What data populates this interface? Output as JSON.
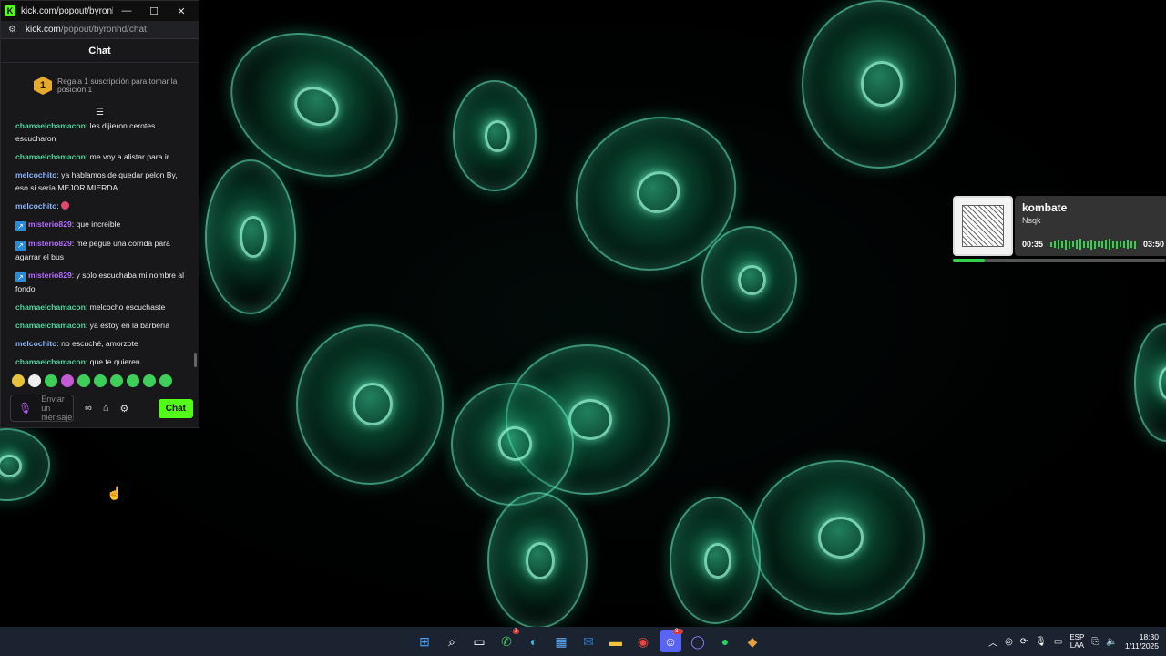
{
  "window": {
    "title": "kick.com/popout/byronhd/c...",
    "url_host": "kick.com",
    "url_path": "/popout/byronhd/chat",
    "minimize": "—",
    "maximize": "☐",
    "close": "✕"
  },
  "chat": {
    "header": "Chat",
    "promo_rank": "1",
    "promo_text": "Regala 1 suscripción para tomar la posición 1",
    "messages": [
      {
        "user": "chamaelchamacon",
        "text": ": les dijieron cerotes escucharon"
      },
      {
        "user": "chamaelchamacon",
        "text": ": me voy a alistar para ir"
      },
      {
        "user": "melcochito",
        "text": ": ya hablamos de quedar pelon By, eso si sería MEJOR MIERDA"
      },
      {
        "user": "melcochito",
        "text": ": "
      },
      {
        "user": "misterio829",
        "text": ": que increible"
      },
      {
        "user": "misterio829",
        "text": ": me pegue una corrida para agarrar el bus"
      },
      {
        "user": "misterio829",
        "text": ": y solo escuchaba mi nombre al fondo"
      },
      {
        "user": "chamaelchamacon",
        "text": ": melcocho escuchaste"
      },
      {
        "user": "chamaelchamacon",
        "text": ": ya estoy en la barbería"
      },
      {
        "user": "melcochito",
        "text": ": no escuché, amorzote"
      },
      {
        "user": "chamaelchamacon",
        "text": ": que te quieren"
      }
    ],
    "input_placeholder": "Enviar un mensaje",
    "send_label": "Chat"
  },
  "music": {
    "song": "kombate",
    "artist": "Nsqk",
    "elapsed": "00:35",
    "duration": "03:50",
    "progress": 0.15
  },
  "taskbar": {
    "whatsapp_badge": "7",
    "discord_badge": "9+",
    "lang_top": "ESP",
    "lang_bottom": "LAA",
    "time": "18:30",
    "date": "1/11/2025"
  }
}
